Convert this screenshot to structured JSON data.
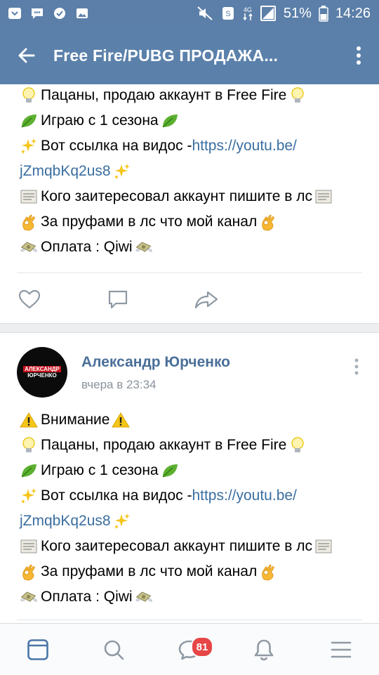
{
  "status_bar": {
    "battery_percent": "51%",
    "time": "14:26",
    "network": "4G",
    "icons": [
      "notification-icon",
      "message-icon",
      "app-icon",
      "gallery-icon",
      "mute-icon",
      "data-saver-icon",
      "signal-icon",
      "sim-icon",
      "battery-icon"
    ]
  },
  "app_bar": {
    "title": "Free Fire/PUBG   ПРОДАЖА...",
    "back_icon": "arrow-left-icon",
    "menu_icon": "more-vertical-icon"
  },
  "post1": {
    "lines": [
      {
        "before": "bulb",
        "text": "Пацаны, продаю аккаунт в Free Fire",
        "after": "bulb"
      },
      {
        "before": "leaf",
        "text": "Играю с 1 сезона",
        "after": "leaf"
      },
      {
        "before": "sparkles",
        "text": "Вот ссылка на видос - ",
        "link": "https://youtu.be/"
      },
      {
        "link": "jZmqbKq2us8",
        "after": "sparkles"
      },
      {
        "before": "scroll",
        "text": "Кого заитересовал аккаунт пишите в лс",
        "after": "scroll"
      },
      {
        "before": "ok-hand",
        "text": "За пруфами в лс что мой канал",
        "after": "ok-hand"
      },
      {
        "before": "money",
        "text": "Оплата : Qiwi",
        "after": "money"
      }
    ]
  },
  "post2": {
    "author": "Александр Юрченко",
    "date": "вчера в 23:34",
    "avatar_text_line1": "АЛЕКСАНДР",
    "avatar_text_line2": "ЮРЧЕНКО",
    "lines": [
      {
        "before": "warning",
        "text": "Внимание",
        "after": "warning"
      },
      {
        "before": "bulb",
        "text": "Пацаны, продаю аккаунт в Free Fire",
        "after": "bulb"
      },
      {
        "before": "leaf",
        "text": "Играю с 1 сезона",
        "after": "leaf"
      },
      {
        "before": "sparkles",
        "text": "Вот ссылка на видос - ",
        "link": "https://youtu.be/"
      },
      {
        "link": "jZmqbKq2us8",
        "after": "sparkles"
      },
      {
        "before": "scroll",
        "text": "Кого заитересовал аккаунт пишите в лс",
        "after": "scroll"
      },
      {
        "before": "ok-hand",
        "text": "За пруфами в лс что мой канал",
        "after": "ok-hand"
      },
      {
        "before": "money",
        "text": "Оплата : Qiwi",
        "after": "money"
      }
    ]
  },
  "bottom_nav": {
    "messages_badge": "81",
    "items": [
      "news-icon",
      "search-icon",
      "messages-icon",
      "notifications-icon",
      "menu-icon"
    ]
  },
  "colors": {
    "header_bg": "#5b81ab",
    "link": "#3a6ea0",
    "author": "#4a6f99",
    "badge": "#e64646",
    "nav_active": "#4a76a8"
  }
}
